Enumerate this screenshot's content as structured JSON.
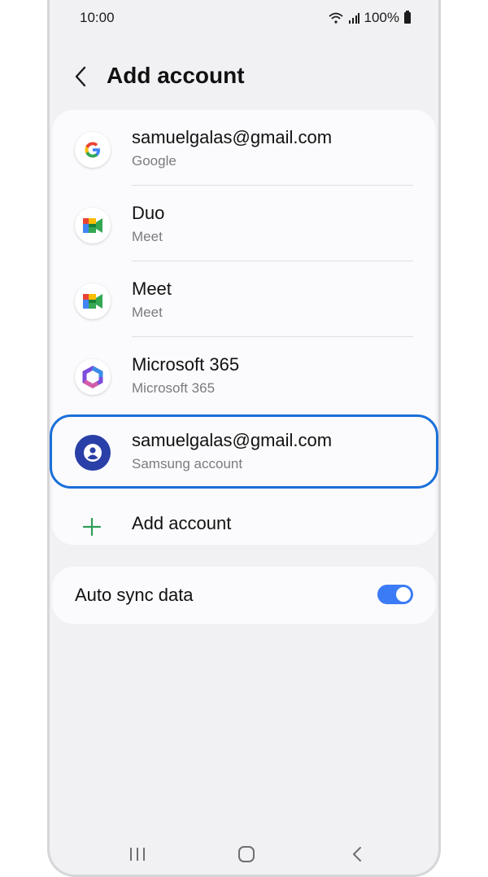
{
  "status_bar": {
    "time": "10:00",
    "battery": "100%"
  },
  "header": {
    "title": "Add account"
  },
  "accounts": [
    {
      "name": "samuelgalas@gmail.com",
      "provider": "Google",
      "icon": "google-icon"
    },
    {
      "name": "Duo",
      "provider": "Meet",
      "icon": "meet-icon"
    },
    {
      "name": "Meet",
      "provider": "Meet",
      "icon": "meet-icon"
    },
    {
      "name": "Microsoft 365",
      "provider": "Microsoft 365",
      "icon": "microsoft-365-icon"
    },
    {
      "name": "samuelgalas@gmail.com",
      "provider": "Samsung account",
      "icon": "samsung-account-icon"
    }
  ],
  "add_account_label": "Add account",
  "auto_sync": {
    "label": "Auto sync data",
    "enabled": true
  },
  "colors": {
    "accent": "#1a6fd9",
    "toggle": "#3b7bf6",
    "add_icon": "#2e9d57"
  }
}
